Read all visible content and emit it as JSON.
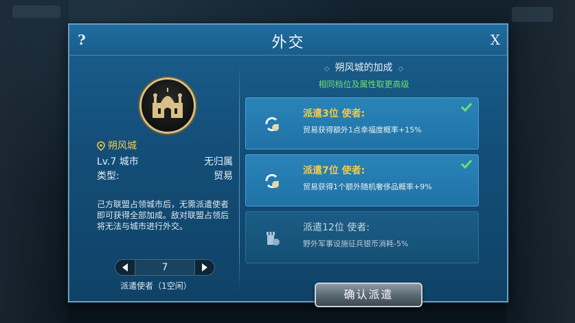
{
  "dialog": {
    "title": "外交",
    "help_label": "?",
    "close_label": "X"
  },
  "city": {
    "name": "朔风城",
    "level": "Lv.7 城市",
    "ownership": "无归属",
    "type_label": "类型:",
    "type_value": "贸易",
    "description": "己方联盟占领城市后，无需派遣使者即可获得全部加成。敌对联盟占领后将无法与城市进行外交。"
  },
  "stepper": {
    "value": "7",
    "label": "派遣使者（1空闲）"
  },
  "bonus": {
    "title": "朔风城的加成",
    "subtitle": "相同档位及属性取更高级",
    "tiers": [
      {
        "title": "派遣3位 使者:",
        "description": "贸易获得额外1点幸福度概率+15%",
        "achieved": true
      },
      {
        "title": "派遣7位 使者:",
        "description": "贸易获得1个额外随机奢侈品概率+9%",
        "achieved": true
      },
      {
        "title": "派遣12位 使者:",
        "description": "野外军事设施征兵银币消耗-5%",
        "achieved": false
      }
    ]
  },
  "confirm_label": "确认派遣",
  "colors": {
    "panel": "#1a5f8e",
    "card_active": "#2a84b8",
    "gold_text": "#f2c94c",
    "green_text": "#6fe06f",
    "check": "#6fe06f"
  }
}
